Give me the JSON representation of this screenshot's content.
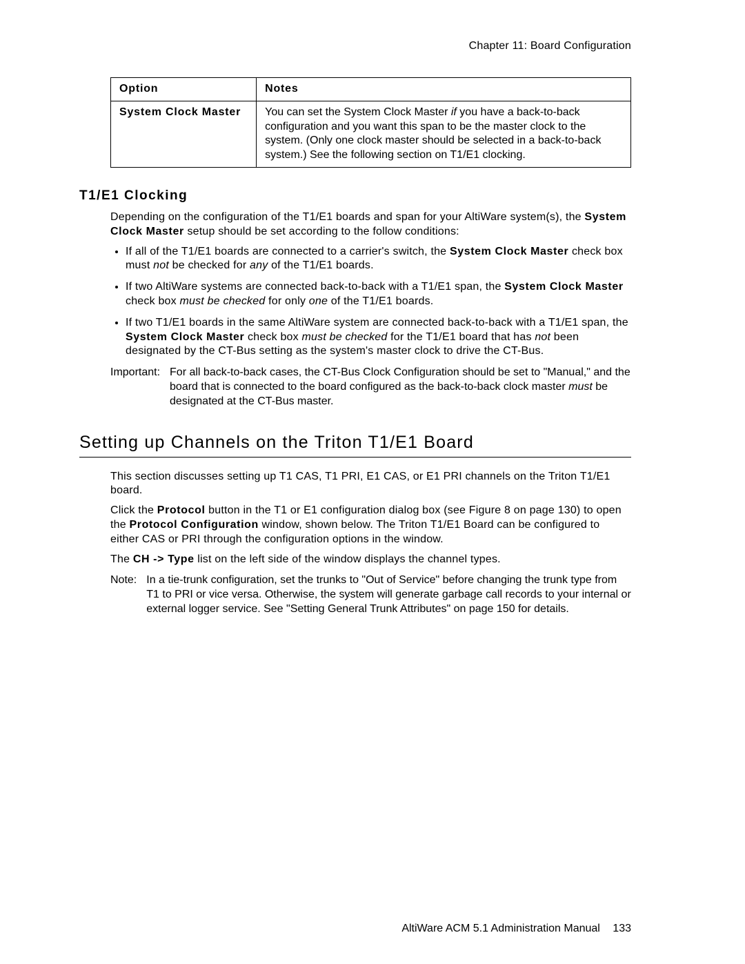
{
  "header": {
    "chapter_label": "Chapter 11:  Board Configuration"
  },
  "table": {
    "headers": {
      "col1": "Option",
      "col2": "Notes"
    },
    "row": {
      "option": "System Clock Master",
      "notes_pre": "You can set the System Clock Master ",
      "notes_if": "if",
      "notes_post": " you have a back-to-back configuration and you want this span to be the master clock to the system. (Only one clock master should be selected in a back-to-back system.) See the following section on T1/E1 clocking."
    }
  },
  "clocking": {
    "heading": "T1/E1 Clocking",
    "intro_pre": "Depending on the configuration of the T1/E1 boards and span for your AltiWare system(s), the ",
    "intro_bold": "System Clock Master",
    "intro_post": " setup should be set according to the follow conditions:",
    "bullets": [
      {
        "pre": "If all of the T1/E1 boards are connected to a carrier's switch, the ",
        "b1": "System Clock Master",
        "mid1": " check box must ",
        "i1": "not",
        "mid2": " be checked for ",
        "i2": "any",
        "post": " of the T1/E1 boards."
      },
      {
        "pre": "If two AltiWare systems are connected back-to-back with a T1/E1 span, the ",
        "b1": "System Clock Master",
        "mid1": " check box ",
        "i1": "must be checked",
        "mid2": " for only ",
        "i2": "one",
        "post": " of the T1/E1 boards."
      },
      {
        "pre": "If two T1/E1 boards in the same AltiWare system are connected back-to-back with a T1/E1 span, the ",
        "b1": "System Clock Master",
        "mid1": " check box ",
        "i1": "must be checked",
        "mid2": " for the T1/E1 board that has ",
        "i2": "not",
        "post": " been designated by the CT-Bus setting as the system's master clock to drive the CT-Bus."
      }
    ],
    "important_label": "Important:",
    "important_pre": "For all back-to-back cases, the CT-Bus Clock Configuration should be set to \"Manual,\" and the board that is connected to the board configured as the back-to-back clock master ",
    "important_i": "must",
    "important_post": " be designated at the CT-Bus master."
  },
  "channels": {
    "heading": "Setting up Channels on the Triton T1/E1 Board",
    "p1": "This section discusses setting up T1 CAS, T1 PRI, E1 CAS, or E1 PRI channels on the Triton T1/E1 board.",
    "p2_pre": "Click the ",
    "p2_b1": "Protocol",
    "p2_mid1": " button in the T1 or E1 configuration dialog box (see Figure 8 on page 130) to open the ",
    "p2_b2": "Protocol Configuration",
    "p2_post": " window, shown below. The Triton T1/E1 Board can be configured to either CAS or PRI through the configuration options in the window.",
    "p3_pre": "The ",
    "p3_b": "CH -> Type",
    "p3_post": " list on the left side of the window displays the channel types.",
    "note_label": "Note:",
    "note_body": "In a tie-trunk configuration, set the trunks to \"Out of Service\" before changing the trunk type from T1 to PRI or vice versa. Otherwise, the system will generate garbage call records to your internal or external logger service. See \"Setting General Trunk Attributes\" on page 150 for details."
  },
  "footer": {
    "manual": "AltiWare ACM 5.1 Administration Manual",
    "page": "133"
  }
}
